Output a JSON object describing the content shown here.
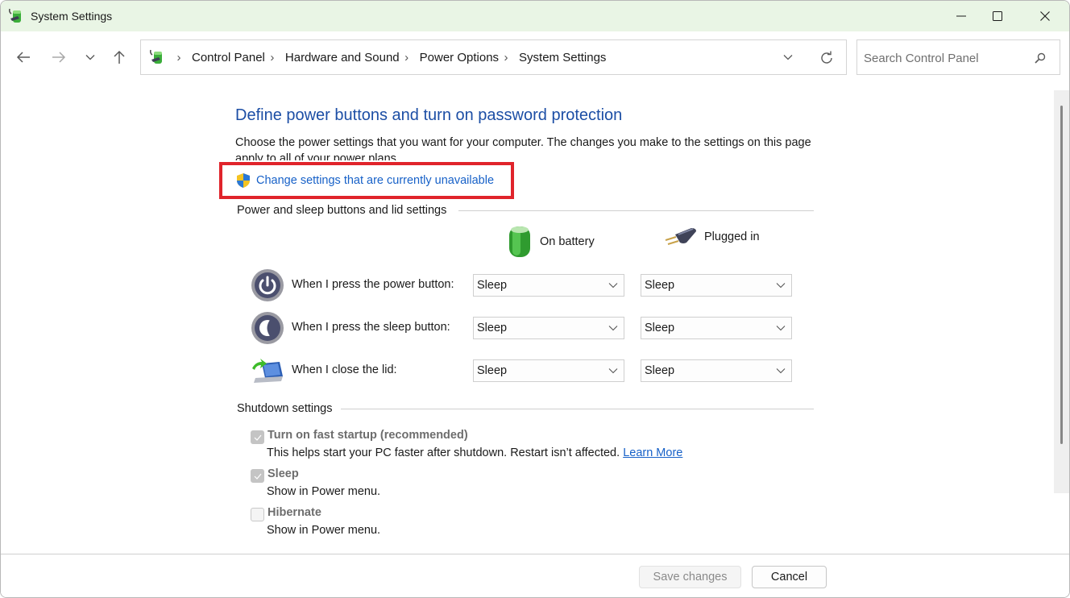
{
  "window": {
    "title": "System Settings",
    "controls": {
      "minimize": "minimize",
      "maximize": "maximize",
      "close": "close"
    }
  },
  "nav": {
    "back_icon": "arrow-left-icon",
    "forward_icon": "arrow-right-icon",
    "recent_icon": "chevron-down-icon",
    "up_icon": "arrow-up-icon"
  },
  "address": {
    "breadcrumbs": [
      "Control Panel",
      "Hardware and Sound",
      "Power Options",
      "System Settings"
    ],
    "separator": "›"
  },
  "search": {
    "placeholder": "Search Control Panel",
    "value": ""
  },
  "page": {
    "title": "Define power buttons and turn on password protection",
    "description": "Choose the power settings that you want for your computer. The changes you make to the settings on this page apply to all of your power plans.",
    "uac_link": "Change settings that are currently unavailable"
  },
  "power_section": {
    "header": "Power and sleep buttons and lid settings",
    "columns": {
      "battery": "On battery",
      "plugged": "Plugged in"
    },
    "rows": [
      {
        "label": "When I press the power button:",
        "battery": "Sleep",
        "plugged": "Sleep"
      },
      {
        "label": "When I press the sleep button:",
        "battery": "Sleep",
        "plugged": "Sleep"
      },
      {
        "label": "When I close the lid:",
        "battery": "Sleep",
        "plugged": "Sleep"
      }
    ]
  },
  "shutdown_section": {
    "header": "Shutdown settings",
    "items": [
      {
        "label": "Turn on fast startup (recommended)",
        "description": "This helps start your PC faster after shutdown. Restart isn’t affected.",
        "link": "Learn More",
        "checked": true,
        "enabled": false
      },
      {
        "label": "Sleep",
        "description": "Show in Power menu.",
        "checked": true,
        "enabled": false
      },
      {
        "label": "Hibernate",
        "description": "Show in Power menu.",
        "checked": false,
        "enabled": false
      }
    ]
  },
  "footer": {
    "save_label": "Save changes",
    "save_enabled": false,
    "cancel_label": "Cancel"
  },
  "colors": {
    "titlebar_bg": "#e9f5e5",
    "heading_blue": "#1c4ea5",
    "link_blue": "#1761c8",
    "highlight_red": "#e0242b"
  }
}
